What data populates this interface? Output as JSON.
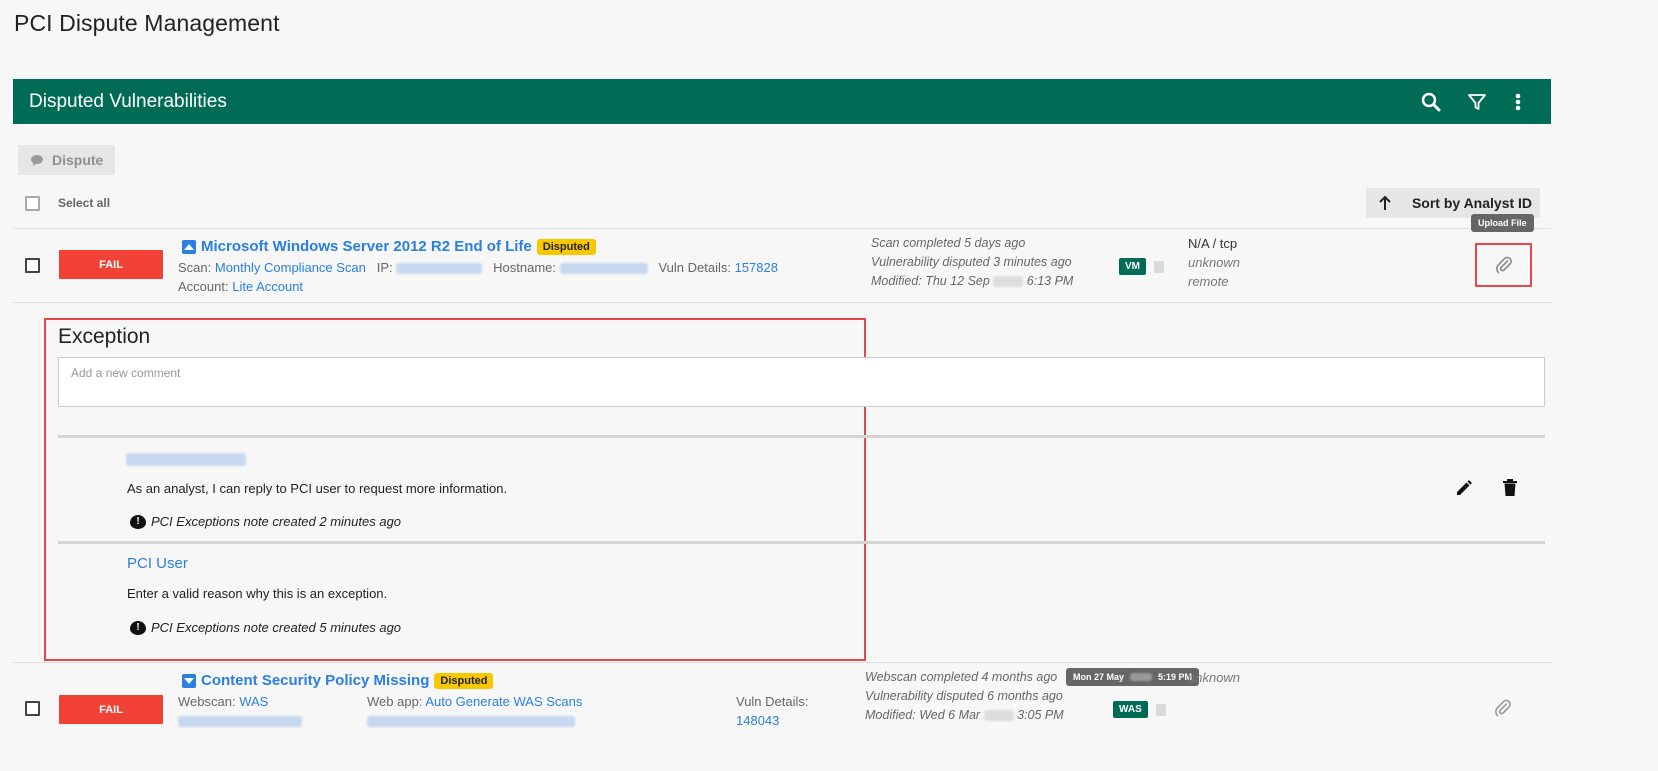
{
  "page": {
    "title": "PCI Dispute Management"
  },
  "header": {
    "title": "Disputed Vulnerabilities",
    "icons": [
      "search-icon",
      "filter-icon",
      "more-vert-icon"
    ],
    "color": "#006c55"
  },
  "toolbar": {
    "dispute_label": "Dispute",
    "select_all_label": "Select all",
    "sort_label": "Sort by Analyst ID"
  },
  "rows": [
    {
      "status": "FAIL",
      "title": "Microsoft Windows Server 2012 R2 End of Life",
      "badge": "Disputed",
      "scan_label": "Scan:",
      "scan_value": "Monthly Compliance Scan",
      "ip_label": "IP:",
      "hostname_label": "Hostname:",
      "vuln_label": "Vuln Details:",
      "vuln_value": "157828",
      "account_label": "Account:",
      "account_value": "Lite Account",
      "timeline": [
        "Scan completed 5 days ago",
        "Vulnerability disputed 3 minutes ago",
        "Modified: Thu 12 Sep",
        "6:13 PM"
      ],
      "tag": "VM",
      "proto": [
        "N/A / tcp",
        "unknown",
        "remote"
      ],
      "upload_tooltip": "Upload File"
    },
    {
      "status": "FAIL",
      "title": "Content Security Policy Missing",
      "badge": "Disputed",
      "scan_label": "Webscan:",
      "scan_value": "WAS",
      "webapp_label": "Web app:",
      "webapp_value": "Auto Generate WAS Scans",
      "vuln_label": "Vuln Details:",
      "vuln_value": "148043",
      "timeline": [
        "Webscan completed 4 months ago",
        "Vulnerability disputed 6 months ago",
        "Modified: Wed 6 Mar",
        "3:05 PM"
      ],
      "tooltip": [
        "Mon 27 May",
        "5:19 PM"
      ],
      "tag": "WAS",
      "proto": "unknown"
    }
  ],
  "exception": {
    "title": "Exception",
    "placeholder": "Add a new comment",
    "comments": [
      {
        "author_blurred": true,
        "body": "As an analyst, I can reply to PCI user to request more information.",
        "note": "PCI Exceptions note created 2 minutes ago"
      },
      {
        "author": "PCI User",
        "body": "Enter a valid reason why this is an exception.",
        "note": "PCI Exceptions note created 5 minutes ago"
      }
    ]
  }
}
